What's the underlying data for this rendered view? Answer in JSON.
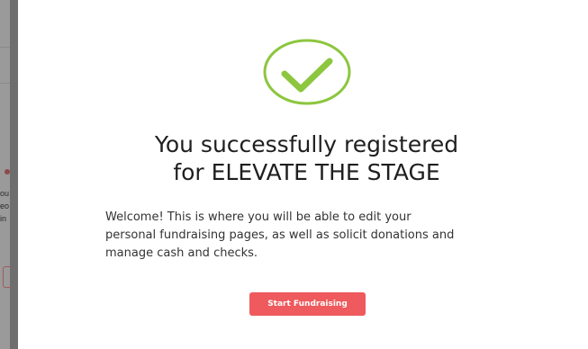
{
  "colors": {
    "accent": "#ee5a5d",
    "success": "#8dc63f",
    "backdrop": "#6e6e6e"
  },
  "backdrop": {
    "fragments": [
      "ou",
      "eo",
      "in"
    ]
  },
  "modal": {
    "icon": "check-circle-icon",
    "title_line1": "You successfully registered",
    "title_line2": "for ELEVATE THE STAGE",
    "body_lines": [
      "Welcome! This is where you will be able to edit your",
      "personal fundraising pages, as well as solicit donations and",
      "manage cash and checks."
    ],
    "button_label": "Start Fundraising"
  }
}
